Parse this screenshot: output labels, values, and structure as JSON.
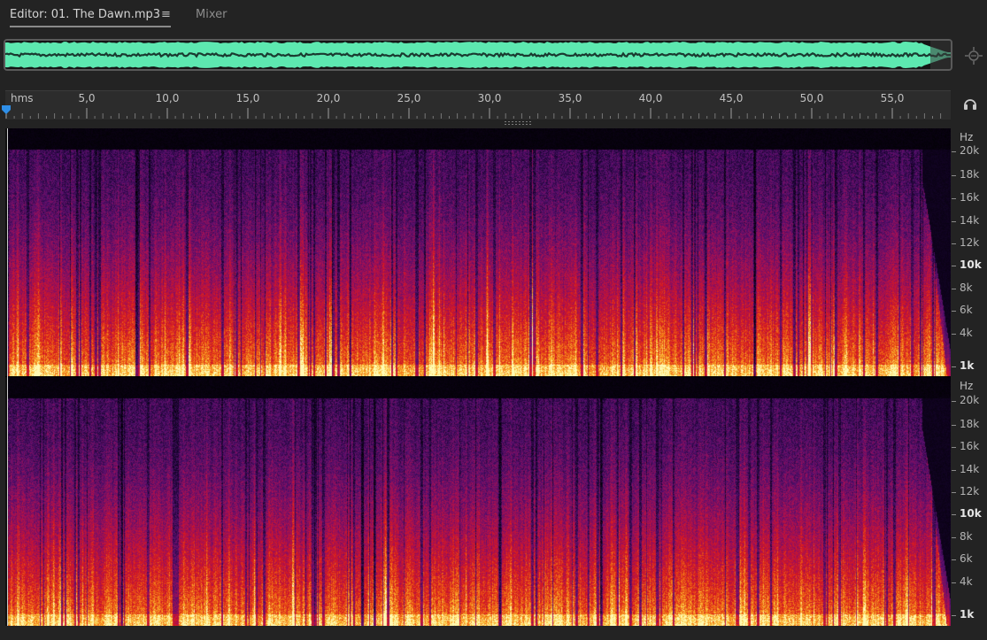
{
  "tabs": {
    "editor_label": "Editor: 01. The Dawn.mp3",
    "menu_glyph": "≡",
    "mixer_label": "Mixer"
  },
  "ruler": {
    "unit": "hms",
    "ticks": [
      "5,0",
      "10,0",
      "15,0",
      "20,0",
      "25,0",
      "30,0",
      "35,0",
      "40,0",
      "45,0",
      "50,0",
      "55,0"
    ]
  },
  "frequency_axis": {
    "unit": "Hz",
    "labels": [
      "20k",
      "18k",
      "16k",
      "14k",
      "12k",
      "10k",
      "8k",
      "6k",
      "4k",
      "1k"
    ],
    "bold": [
      "10k",
      "1k"
    ]
  },
  "colors": {
    "waveform": "#5de8b0",
    "playhead": "#2f8fe8",
    "spectral_low": "#1a0530",
    "spectral_mid": "#c8102e",
    "spectral_high": "#ffe060"
  },
  "icons": {
    "zoom": "zoom-to-fit-icon",
    "monitor": "headphones-icon",
    "playhead": "playhead-marker-icon"
  }
}
